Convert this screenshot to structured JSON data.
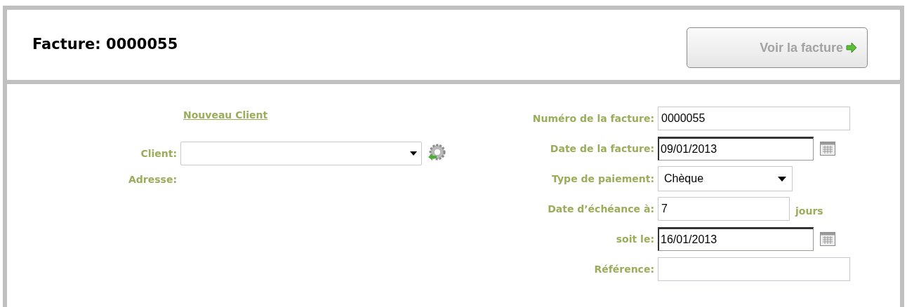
{
  "header": {
    "title": "Facture: 0000055",
    "view_button": "Voir la facture"
  },
  "client_panel": {
    "new_client_link": "Nouveau Client",
    "client_label": "Client:",
    "address_label": "Adresse:"
  },
  "invoice_fields": [
    {
      "kind": "text",
      "label": "Numéro de la facture:",
      "value": "0000055"
    },
    {
      "kind": "date",
      "label": "Date de la facture:",
      "value": "09/01/2013"
    },
    {
      "kind": "select",
      "label": "Type de paiement:",
      "value": "Chèque"
    },
    {
      "kind": "days",
      "label": "Date d’échéance à:",
      "value": "7",
      "suffix": "jours"
    },
    {
      "kind": "date",
      "label": "soit le:",
      "value": "16/01/2013"
    },
    {
      "kind": "text",
      "label": "Référence:"
    }
  ]
}
